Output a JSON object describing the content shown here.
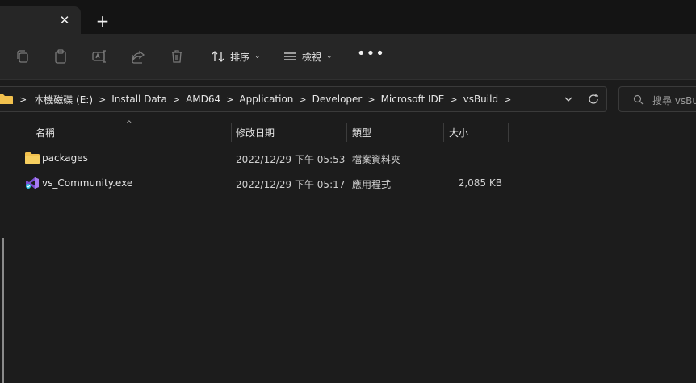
{
  "tab": {
    "close_glyph": "✕",
    "new_tab_glyph": "+"
  },
  "toolbar": {
    "icons": [
      "copy-icon",
      "paste-icon",
      "rename-icon",
      "share-icon",
      "delete-icon"
    ],
    "sort_label": "排序",
    "view_label": "檢視",
    "more_label": "•••"
  },
  "address": {
    "crumbs": [
      "本機磁碟 (E:)",
      "Install Data",
      "AMD64",
      "Application",
      "Developer",
      "Microsoft IDE",
      "vsBuild"
    ]
  },
  "search": {
    "placeholder": "搜尋 vsBui"
  },
  "columns": {
    "name": "名稱",
    "date": "修改日期",
    "type": "類型",
    "size": "大小"
  },
  "files": [
    {
      "name": "packages",
      "date": "2022/12/29 下午 05:53",
      "type": "檔案資料夾",
      "size": "",
      "icon": "folder-icon"
    },
    {
      "name": "vs_Community.exe",
      "date": "2022/12/29 下午 05:17",
      "type": "應用程式",
      "size": "2,085 KB",
      "icon": "visual-studio-icon"
    }
  ],
  "colors": {
    "background": "#1c1c1c",
    "toolbar": "#262626",
    "folder": "#f2c14e",
    "vs_purple": "#9a6cf0"
  }
}
